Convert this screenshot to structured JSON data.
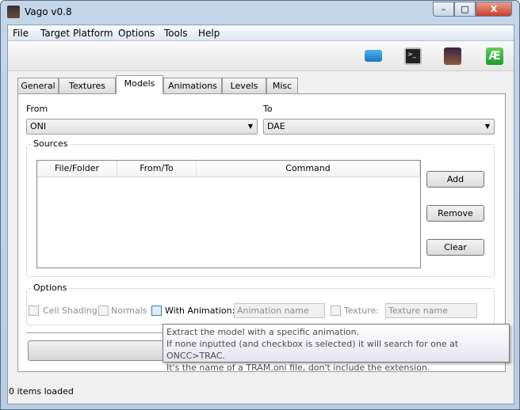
{
  "window": {
    "title": "Vago v0.8",
    "minimize": "–",
    "maximize": "□",
    "close": "X"
  },
  "menu": [
    "File",
    "Target Platform",
    "Options",
    "Tools",
    "Help"
  ],
  "toolbar": {
    "icons": [
      "folder-icon",
      "terminal-icon",
      "character-avatar-icon",
      "ae-icon"
    ],
    "ae_glyph": "Æ"
  },
  "tabs": [
    {
      "label": "General"
    },
    {
      "label": "Textures"
    },
    {
      "label": "Models",
      "active": true
    },
    {
      "label": "Animations"
    },
    {
      "label": "Levels"
    },
    {
      "label": "Misc"
    }
  ],
  "from": {
    "label": "From",
    "value": "ONI"
  },
  "to": {
    "label": "To",
    "value": "DAE"
  },
  "sources": {
    "title": "Sources",
    "columns": [
      "File/Folder",
      "From/To",
      "Command"
    ],
    "rows": [],
    "add": "Add",
    "remove": "Remove",
    "clear": "Clear"
  },
  "options": {
    "title": "Options",
    "cell_shading": "Cell Shading",
    "normals": "Normals",
    "with_animation": "With Animation:",
    "animation_placeholder": "Animation name",
    "texture": "Texture:",
    "texture_placeholder": "Texture name"
  },
  "tooltip": [
    "Extract the model with a specific animation.",
    "If none inputted (and checkbox is selected) it will search for one at ONCC>TRAC.",
    "It's the name of a TRAM.oni file, don't include the extension."
  ],
  "status": "0 items loaded"
}
